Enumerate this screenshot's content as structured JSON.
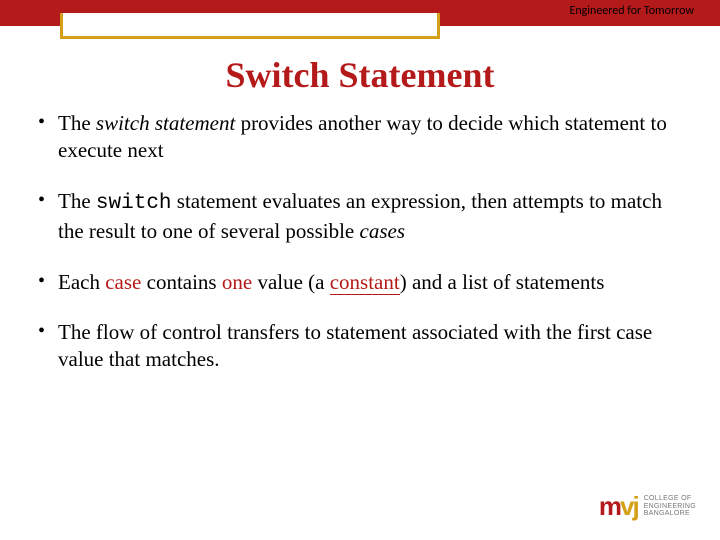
{
  "header": {
    "tagline": "Engineered for Tomorrow"
  },
  "title": "Switch Statement",
  "bullets": {
    "b1": {
      "start": "The ",
      "kw": "switch statement",
      "end": " provides another way to decide which statement to execute next"
    },
    "b2": {
      "start": "The ",
      "code": "switch",
      "mid": " statement evaluates an expression, then attempts to match the result to one of several possible ",
      "kw": "cases"
    },
    "b3": {
      "start": "Each ",
      "kw1": "case",
      "mid1": " contains ",
      "kw2": "one",
      "mid2": " value (a ",
      "kw3": "constant",
      "end": ") and a list of statements"
    },
    "b4": {
      "text": "The flow of control transfers to statement associated with the first case value that matches."
    }
  },
  "logo": {
    "m": "m",
    "vj": "vj",
    "line1": "COLLEGE OF",
    "line2": "ENGINEERING",
    "line3": "BANGALORE"
  }
}
